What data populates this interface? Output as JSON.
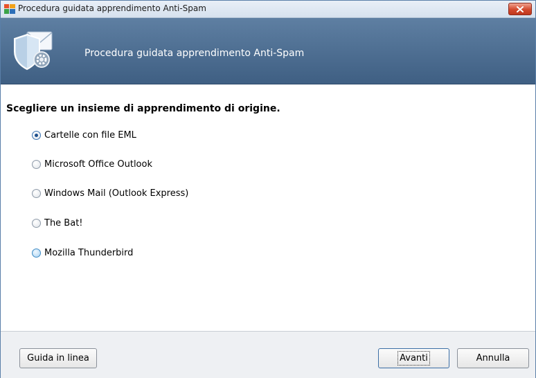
{
  "window": {
    "title": "Procedura guidata apprendimento Anti-Spam"
  },
  "banner": {
    "title": "Procedura guidata apprendimento Anti-Spam"
  },
  "content": {
    "question": "Scegliere un insieme di apprendimento di origine.",
    "options": [
      {
        "label": "Cartelle con file EML",
        "selected": true
      },
      {
        "label": "Microsoft Office Outlook",
        "selected": false
      },
      {
        "label": "Windows Mail (Outlook Express)",
        "selected": false
      },
      {
        "label": "The Bat!",
        "selected": false
      },
      {
        "label": "Mozilla Thunderbird",
        "selected": false
      }
    ]
  },
  "footer": {
    "help_label": "Guida in linea",
    "next_label": "Avanti",
    "cancel_label": "Annulla"
  },
  "icons": {
    "app": "avg-app-icon",
    "banner": "mail-shield-gear-icon",
    "close": "close-icon",
    "radio": "radio-icon"
  },
  "colors": {
    "banner": "#4d6e93",
    "close_button": "#d2492d",
    "footer": "#eef0f3"
  }
}
